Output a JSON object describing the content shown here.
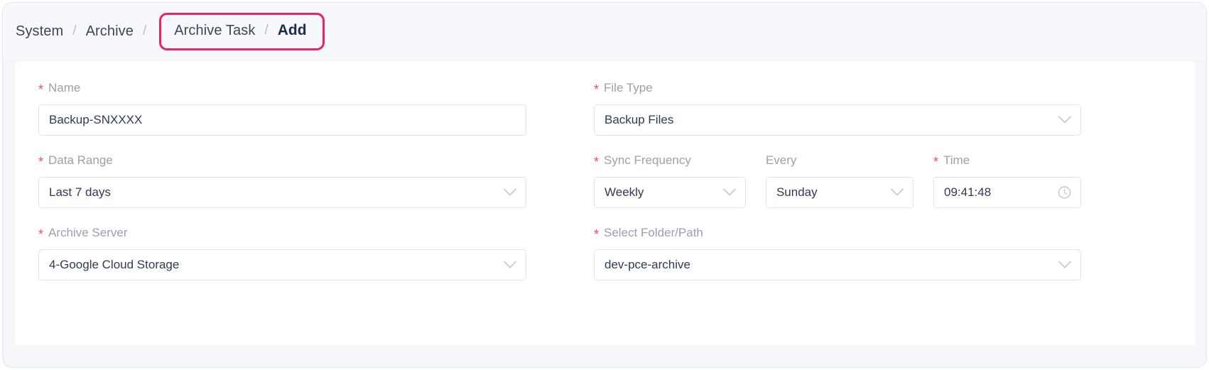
{
  "breadcrumb": {
    "items": [
      {
        "label": "System",
        "current": false
      },
      {
        "label": "Archive",
        "current": false
      },
      {
        "label": "Archive Task",
        "current": false
      },
      {
        "label": "Add",
        "current": true
      }
    ],
    "separator": "/",
    "highlight_color": "#f0215c"
  },
  "form": {
    "required_marker": "*",
    "left": {
      "name": {
        "label": "Name",
        "required": true,
        "value": "Backup-SNXXXX",
        "type": "text"
      },
      "data_range": {
        "label": "Data Range",
        "required": true,
        "value": "Last 7 days",
        "type": "select",
        "icon": "chevron-down-icon"
      },
      "archive_server": {
        "label": "Archive Server",
        "required": true,
        "value": "4-Google Cloud Storage",
        "type": "select",
        "icon": "chevron-down-icon"
      }
    },
    "right": {
      "file_type": {
        "label": "File Type",
        "required": true,
        "value": "Backup Files",
        "type": "select",
        "icon": "chevron-down-icon"
      },
      "sync_frequency": {
        "label": "Sync Frequency",
        "required": true,
        "value": "Weekly",
        "type": "select",
        "icon": "chevron-down-icon"
      },
      "every": {
        "label": "Every",
        "required": false,
        "value": "Sunday",
        "type": "select",
        "icon": "chevron-down-icon"
      },
      "time": {
        "label": "Time",
        "required": true,
        "value": "09:41:48",
        "type": "time",
        "icon": "clock-icon"
      },
      "select_folder_path": {
        "label": "Select Folder/Path",
        "required": true,
        "value": "dev-pce-archive",
        "type": "select",
        "icon": "chevron-down-icon"
      }
    }
  },
  "colors": {
    "page_background": "#f4f6fa",
    "card_background": "#ffffff",
    "label_text": "#9aa0ad",
    "value_text": "#2f3b52",
    "required_star": "#ec4b5e",
    "border": "#dfe3ea",
    "highlight": "#f0215c"
  }
}
